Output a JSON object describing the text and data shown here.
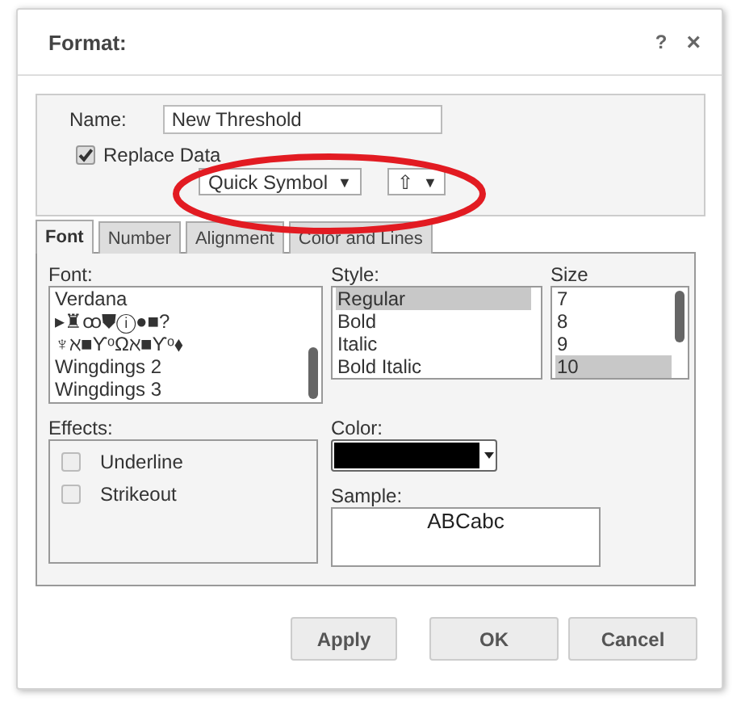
{
  "dialog": {
    "title": "Format:",
    "help": "?",
    "close": "×"
  },
  "name": {
    "label": "Name:",
    "value": "New Threshold"
  },
  "replace": {
    "label": "Replace Data",
    "checked": true
  },
  "quick_symbol": {
    "value": "Quick Symbol",
    "arrow": "▼"
  },
  "symbol_select": {
    "value": "⇧",
    "arrow": "▼"
  },
  "tabs": [
    {
      "label": "Font",
      "selected": true
    },
    {
      "label": "Number",
      "selected": false
    },
    {
      "label": "Alignment",
      "selected": false
    },
    {
      "label": "Color and Lines",
      "selected": false
    }
  ],
  "font": {
    "label": "Font:",
    "items": [
      "Verdana",
      "▸♜ꝏ⛊ⓘ●■?",
      "♆ℵ■ϒᵒΩℵ■ϒᵒ⬧",
      "Wingdings 2",
      "Wingdings 3"
    ]
  },
  "style": {
    "label": "Style:",
    "items": [
      {
        "text": "Regular",
        "selected": true
      },
      {
        "text": "Bold",
        "selected": false
      },
      {
        "text": "Italic",
        "selected": false
      },
      {
        "text": "Bold Italic",
        "selected": false
      }
    ]
  },
  "size": {
    "label": "Size",
    "items": [
      {
        "text": "7",
        "selected": false
      },
      {
        "text": "8",
        "selected": false
      },
      {
        "text": "9",
        "selected": false
      },
      {
        "text": "10",
        "selected": true
      }
    ]
  },
  "effects": {
    "label": "Effects:",
    "items": [
      {
        "label": "Underline",
        "checked": false
      },
      {
        "label": "Strikeout",
        "checked": false
      }
    ]
  },
  "color": {
    "label": "Color:",
    "color": "#000000"
  },
  "sample": {
    "label": "Sample:",
    "text": "ABCabc"
  },
  "buttons": [
    "Apply",
    "OK",
    "Cancel"
  ]
}
